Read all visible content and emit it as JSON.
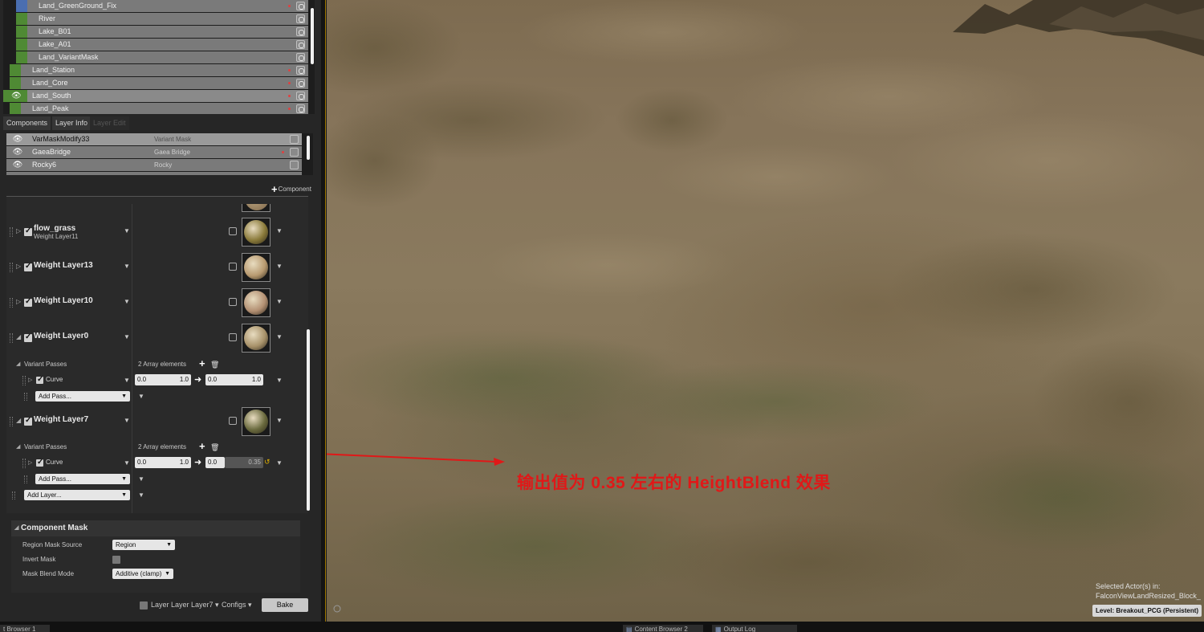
{
  "landscape_list": {
    "rows": [
      {
        "name": "Land_GreenGround_Fix",
        "color": "#4a6eb0",
        "dirty": true,
        "indent": 1
      },
      {
        "name": "River",
        "color": "#4f8a34",
        "dirty": false,
        "indent": 1
      },
      {
        "name": "Lake_B01",
        "color": "#4f8a34",
        "dirty": false,
        "indent": 1
      },
      {
        "name": "Lake_A01",
        "color": "#4f8a34",
        "dirty": false,
        "indent": 1
      },
      {
        "name": "Land_VariantMask",
        "color": "#4f8a34",
        "dirty": false,
        "indent": 1
      },
      {
        "name": "Land_Station",
        "color": "#4f8a34",
        "dirty": true,
        "indent": 0
      },
      {
        "name": "Land_Core",
        "color": "#4f8a34",
        "dirty": true,
        "indent": 0
      },
      {
        "name": "Land_South",
        "color": "#4f8a34",
        "dirty": true,
        "indent": 0,
        "visible": true
      },
      {
        "name": "Land_Peak",
        "color": "#4f8a34",
        "dirty": true,
        "indent": 0
      }
    ]
  },
  "tabs": [
    {
      "label": "Components",
      "enabled": true
    },
    {
      "label": "Layer Info",
      "enabled": true
    },
    {
      "label": "Layer Edit",
      "enabled": false
    }
  ],
  "components": {
    "rows": [
      {
        "name": "VarMaskModify33",
        "type": "Variant Mask"
      },
      {
        "name": "GaeaBridge",
        "type": "Gaea Bridge"
      },
      {
        "name": "Rocky6",
        "type": "Rocky"
      }
    ],
    "add_label": "Component"
  },
  "layers": [
    {
      "name": "flow_grass",
      "sub": "Weight Layer11",
      "checked": true,
      "ball": "#8a7a3a"
    },
    {
      "name": "Weight Layer13",
      "sub": "",
      "checked": true,
      "ball": "#b89a70"
    },
    {
      "name": "Weight Layer10",
      "sub": "",
      "checked": true,
      "ball": "#b39073"
    },
    {
      "name": "Weight Layer0",
      "sub": "",
      "checked": true,
      "ball": "#a8926a"
    },
    {
      "name": "Weight Layer7",
      "sub": "",
      "checked": true,
      "ball": "#6a6a3e"
    }
  ],
  "variant_passes": {
    "label": "Variant Passes",
    "count_label": "2 Array elements",
    "curve_label": "Curve",
    "add_pass": "Add Pass...",
    "layer0_curve": {
      "in_min": "0.0",
      "in_max": "1.0",
      "out_min": "0.0",
      "out_max": "1.0"
    },
    "layer7_curve": {
      "in_min": "0.0",
      "in_max": "1.0",
      "out_min": "0.0",
      "out_max": "0.35"
    }
  },
  "add_layer": "Add Layer...",
  "component_mask": {
    "header": "Component Mask",
    "region_source_label": "Region Mask Source",
    "region_source_value": "Region",
    "invert_label": "Invert Mask",
    "blend_label": "Mask Blend Mode",
    "blend_value": "Additive (clamp)"
  },
  "bottom_bar": {
    "layer_label": "Layer Layer Layer7",
    "configs": "Configs",
    "bake": "Bake"
  },
  "viewport": {
    "annotation": "输出值为 0.35 左右的 HeightBlend 效果",
    "annotation_color": "#e01818",
    "selected_actor_line1": "Selected Actor(s) in:",
    "selected_actor_line2": "FalconViewLandResized_Block_",
    "level_prefix": "Level:",
    "level_name": "Breakout_PCG (Persistent)"
  },
  "task_bar": {
    "tab1": "t Browser 1",
    "tab2": "Content Browser 2",
    "tab3": "Output Log"
  }
}
